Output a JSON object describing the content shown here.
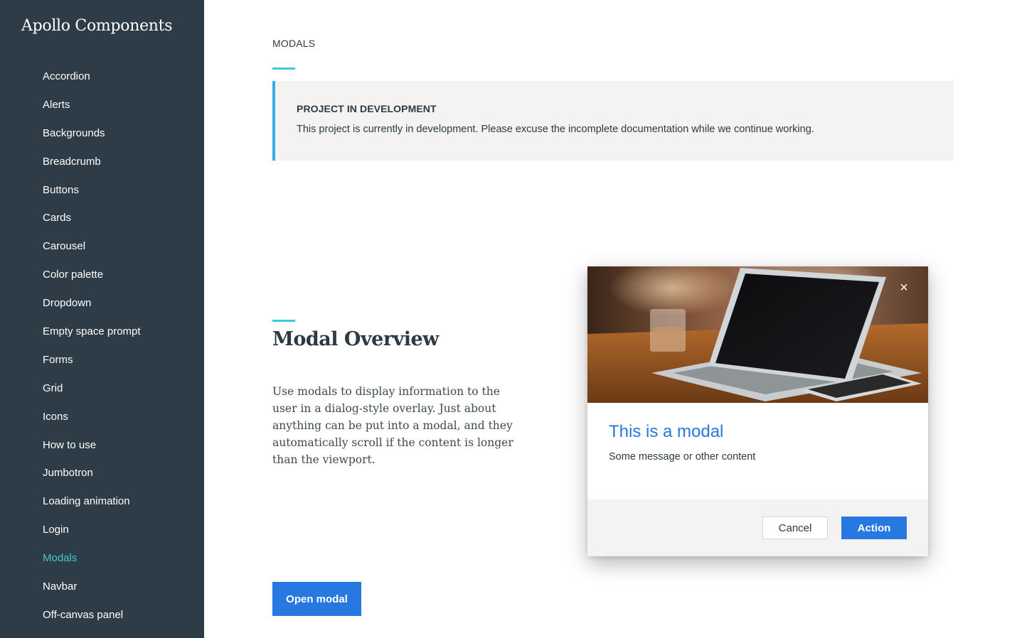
{
  "brand": "Apollo Components",
  "sidebar": {
    "items": [
      {
        "label": "Accordion"
      },
      {
        "label": "Alerts"
      },
      {
        "label": "Backgrounds"
      },
      {
        "label": "Breadcrumb"
      },
      {
        "label": "Buttons"
      },
      {
        "label": "Cards"
      },
      {
        "label": "Carousel"
      },
      {
        "label": "Color palette"
      },
      {
        "label": "Dropdown"
      },
      {
        "label": "Empty space prompt"
      },
      {
        "label": "Forms"
      },
      {
        "label": "Grid"
      },
      {
        "label": "Icons"
      },
      {
        "label": "How to use"
      },
      {
        "label": "Jumbotron"
      },
      {
        "label": "Loading animation"
      },
      {
        "label": "Login"
      },
      {
        "label": "Modals"
      },
      {
        "label": "Navbar"
      },
      {
        "label": "Off-canvas panel"
      }
    ],
    "active_item": "Modals"
  },
  "header": {
    "eyebrow": "MODALS"
  },
  "notice": {
    "title": "PROJECT IN DEVELOPMENT",
    "text": "This project is currently in development. Please excuse the incomplete documentation while we continue working."
  },
  "overview": {
    "title": "Modal Overview",
    "description": "Use modals to display information to the user in a dialog-style overlay. Just about anything can be put into a modal, and they automatically scroll if the content is longer than the viewport.",
    "open_button": "Open modal"
  },
  "modal": {
    "image": "laptop-on-table-photo",
    "close_icon": "close-icon",
    "close_glyph": "×",
    "title": "This is a modal",
    "message": "Some message or other content",
    "cancel_label": "Cancel",
    "action_label": "Action"
  },
  "colors": {
    "sidebar_bg": "#2d3c46",
    "accent_teal": "#3ec9d4",
    "primary_blue": "#2778e0",
    "notice_border": "#3aaee0",
    "panel_gray": "#f4f3f1"
  }
}
